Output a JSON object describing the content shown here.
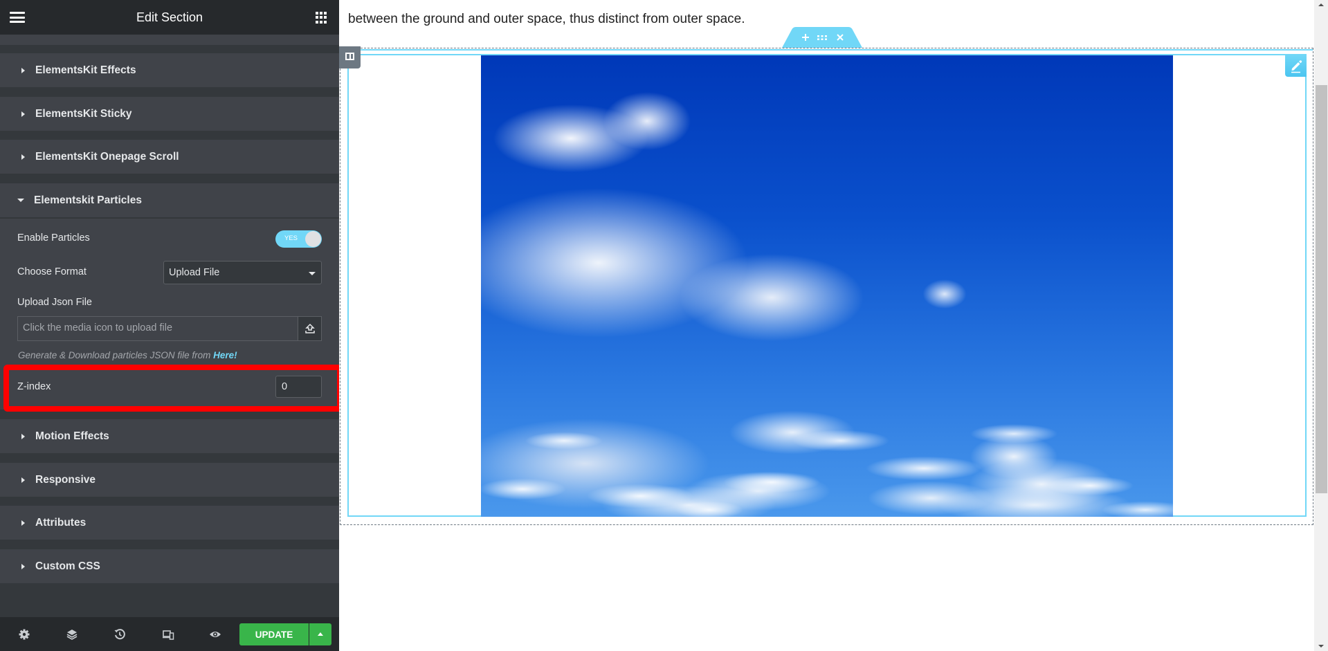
{
  "panel": {
    "header": {
      "title": "Edit Section",
      "menu_icon": "hamburger-icon",
      "widgets_icon": "apps-grid-icon"
    },
    "sections": [
      {
        "label": "ElementsKit Effects",
        "expanded": false
      },
      {
        "label": "ElementsKit Sticky",
        "expanded": false
      },
      {
        "label": "ElementsKit Onepage Scroll",
        "expanded": false
      },
      {
        "label": "Elementskit Particles",
        "expanded": true
      },
      {
        "label": "Motion Effects",
        "expanded": false
      },
      {
        "label": "Responsive",
        "expanded": false
      },
      {
        "label": "Attributes",
        "expanded": false
      },
      {
        "label": "Custom CSS",
        "expanded": false
      }
    ],
    "particles": {
      "enable_label": "Enable Particles",
      "enable_toggle_text": "YES",
      "enable_value": true,
      "format_label": "Choose Format",
      "format_value": "Upload File",
      "upload_label": "Upload Json File",
      "upload_placeholder": "Click the media icon to upload file",
      "note_text": "Generate & Download particles JSON file from ",
      "note_link": "Here!",
      "zindex_label": "Z-index",
      "zindex_value": "0"
    },
    "footer": {
      "icons": [
        "settings-icon",
        "navigator-layers-icon",
        "history-icon",
        "responsive-mode-icon",
        "preview-eye-icon"
      ],
      "update_label": "UPDATE"
    }
  },
  "preview": {
    "paragraph_visible_line": "between the ground and outer space, thus distinct from outer space.",
    "section_tab_icons": [
      "add-section-icon",
      "drag-section-icon",
      "delete-section-icon"
    ],
    "image_alt": "Blue sky with white cumulus clouds"
  },
  "colors": {
    "accent": "#71d7f7",
    "update_green": "#39b54a",
    "highlight_red": "#ff0000",
    "panel_bg": "#404349",
    "panel_header": "#26292c"
  }
}
